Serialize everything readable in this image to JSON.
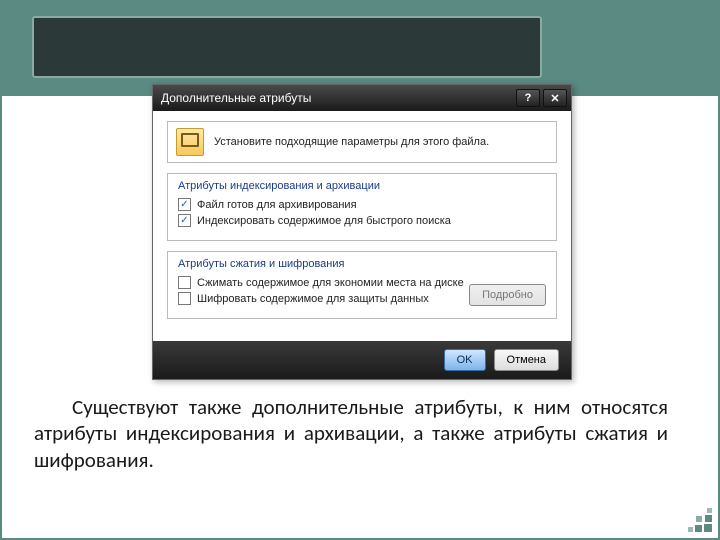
{
  "dialog": {
    "title": "Дополнительные атрибуты",
    "prompt": "Установите подходящие параметры для этого файла.",
    "group1": {
      "title": "Атрибуты индексирования и архивации",
      "opt1": {
        "label": "Файл готов для архивирования",
        "checked": true
      },
      "opt2": {
        "label": "Индексировать содержимое для быстрого поиска",
        "checked": true
      }
    },
    "group2": {
      "title": "Атрибуты сжатия и шифрования",
      "opt1": {
        "label": "Сжимать содержимое для экономии места на диске",
        "checked": false
      },
      "opt2": {
        "label": "Шифровать содержимое для защиты данных",
        "checked": false
      },
      "details": "Подробно"
    },
    "ok": "OK",
    "cancel": "Отмена"
  },
  "caption": "Существуют также дополнительные атрибуты, к ним относятся атрибуты индексирования и архивации, а также атрибуты сжатия и шифрования."
}
